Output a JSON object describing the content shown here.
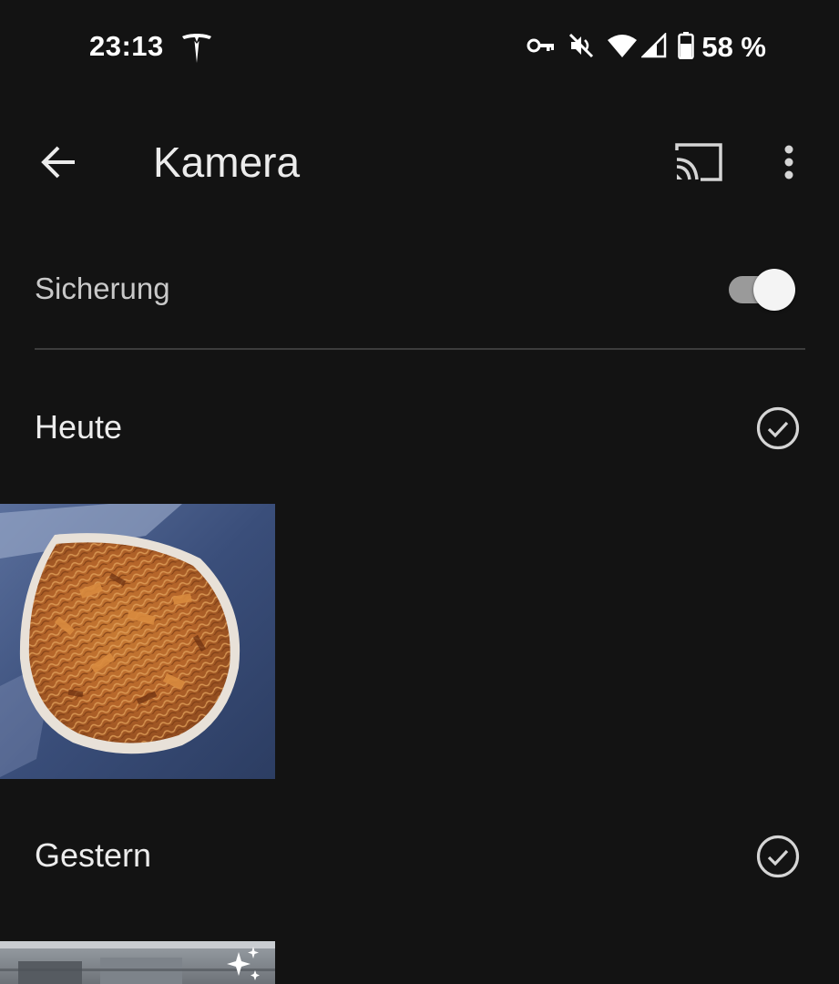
{
  "status_bar": {
    "time": "23:13",
    "battery_text": "58 %",
    "icons": [
      "tesla-icon",
      "vpn-key-icon",
      "mute-icon",
      "wifi-icon",
      "signal-icon",
      "battery-icon"
    ]
  },
  "app_bar": {
    "title": "Kamera",
    "icons": [
      "back-arrow-icon",
      "cast-icon",
      "more-vert-icon"
    ]
  },
  "backup": {
    "label": "Sicherung",
    "enabled": true
  },
  "sections": [
    {
      "title": "Heute",
      "check_icon": "check-circle-icon"
    },
    {
      "title": "Gestern",
      "check_icon": "check-circle-icon"
    }
  ],
  "colors": {
    "background": "#131313",
    "text": "#ececec",
    "secondary_text": "#c9c9c9",
    "divider": "#3c3c3c"
  }
}
